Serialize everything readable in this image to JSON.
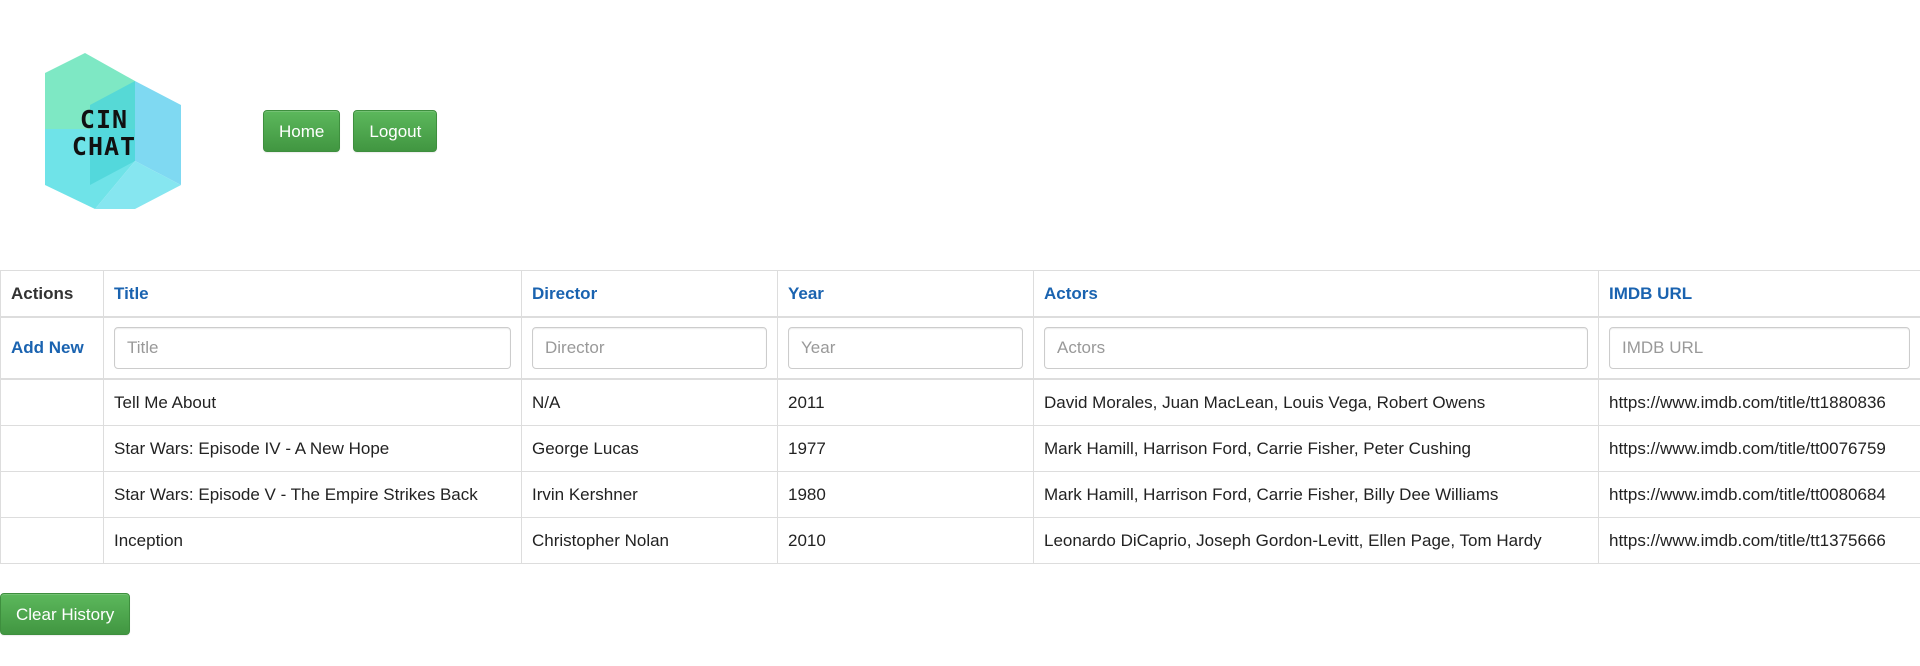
{
  "header": {
    "logo": {
      "line1": "CIN",
      "line2": "CHAT",
      "colors": [
        "#7ee8c4",
        "#4fd6d9",
        "#7fd9f2"
      ]
    },
    "nav": {
      "home_label": "Home",
      "logout_label": "Logout"
    }
  },
  "table": {
    "columns": {
      "actions": "Actions",
      "title": "Title",
      "director": "Director",
      "year": "Year",
      "actors": "Actors",
      "imdb_url": "IMDB URL"
    },
    "filters": {
      "add_new_label": "Add New",
      "title_placeholder": "Title",
      "director_placeholder": "Director",
      "year_placeholder": "Year",
      "actors_placeholder": "Actors",
      "imdb_url_placeholder": "IMDB URL"
    },
    "rows": [
      {
        "title": "Tell Me About",
        "director": "N/A",
        "year": "2011",
        "actors": "David Morales, Juan MacLean, Louis Vega, Robert Owens",
        "imdb_url": "https://www.imdb.com/title/tt1880836"
      },
      {
        "title": "Star Wars: Episode IV - A New Hope",
        "director": "George Lucas",
        "year": "1977",
        "actors": "Mark Hamill, Harrison Ford, Carrie Fisher, Peter Cushing",
        "imdb_url": "https://www.imdb.com/title/tt0076759"
      },
      {
        "title": "Star Wars: Episode V - The Empire Strikes Back",
        "director": "Irvin Kershner",
        "year": "1980",
        "actors": "Mark Hamill, Harrison Ford, Carrie Fisher, Billy Dee Williams",
        "imdb_url": "https://www.imdb.com/title/tt0080684"
      },
      {
        "title": "Inception",
        "director": "Christopher Nolan",
        "year": "2010",
        "actors": "Leonardo DiCaprio, Joseph Gordon-Levitt, Ellen Page, Tom Hardy",
        "imdb_url": "https://www.imdb.com/title/tt1375666"
      }
    ]
  },
  "footer": {
    "clear_history_label": "Clear History"
  },
  "colors": {
    "button_green": "#4cae4c",
    "link_blue": "#1a63b0"
  }
}
